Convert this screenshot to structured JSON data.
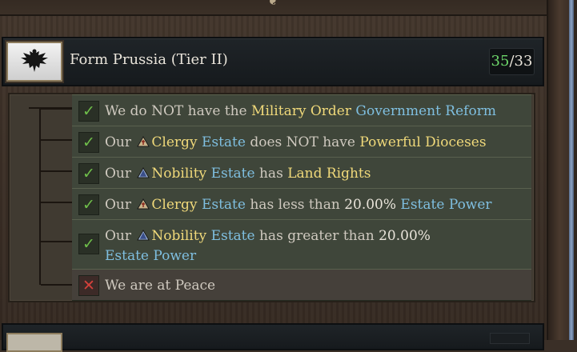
{
  "decision": {
    "title": "Form Prussia (Tier II)",
    "counter_current": "35",
    "counter_sep": "/",
    "counter_total": "33",
    "flag_icon": "black-eagle-flag-icon"
  },
  "conditions": [
    {
      "status": "met",
      "parts": [
        {
          "t": "We do NOT have the ",
          "c": "n"
        },
        {
          "t": "Military Order",
          "c": "y"
        },
        {
          "t": " ",
          "c": "n"
        },
        {
          "t": "Government Reform",
          "c": "b"
        }
      ]
    },
    {
      "status": "met",
      "parts": [
        {
          "t": "Our ",
          "c": "n"
        },
        {
          "icon": "clergy-estate-icon"
        },
        {
          "t": "Clergy",
          "c": "y"
        },
        {
          "t": " ",
          "c": "n"
        },
        {
          "t": "Estate",
          "c": "b"
        },
        {
          "t": " does NOT have ",
          "c": "n"
        },
        {
          "t": "Powerful Dioceses",
          "c": "y"
        }
      ]
    },
    {
      "status": "met",
      "parts": [
        {
          "t": "Our ",
          "c": "n"
        },
        {
          "icon": "nobility-estate-icon"
        },
        {
          "t": "Nobility",
          "c": "y"
        },
        {
          "t": " ",
          "c": "n"
        },
        {
          "t": "Estate",
          "c": "b"
        },
        {
          "t": " has ",
          "c": "n"
        },
        {
          "t": "Land Rights",
          "c": "y"
        }
      ]
    },
    {
      "status": "met",
      "parts": [
        {
          "t": "Our ",
          "c": "n"
        },
        {
          "icon": "clergy-estate-icon"
        },
        {
          "t": "Clergy",
          "c": "y"
        },
        {
          "t": " ",
          "c": "n"
        },
        {
          "t": "Estate",
          "c": "b"
        },
        {
          "t": " has less than ",
          "c": "n"
        },
        {
          "t": "20.00%",
          "c": "w"
        },
        {
          "t": " ",
          "c": "n"
        },
        {
          "t": "Estate Power",
          "c": "b"
        }
      ]
    },
    {
      "status": "met",
      "parts": [
        {
          "t": "Our ",
          "c": "n"
        },
        {
          "icon": "nobility-estate-icon"
        },
        {
          "t": "Nobility",
          "c": "y"
        },
        {
          "t": " ",
          "c": "n"
        },
        {
          "t": "Estate",
          "c": "b"
        },
        {
          "t": " has greater than ",
          "c": "n"
        },
        {
          "t": "20.00%",
          "c": "w"
        },
        {
          "br": true
        },
        {
          "t": "Estate Power",
          "c": "b"
        }
      ]
    },
    {
      "status": "failed",
      "parts": [
        {
          "t": "We are at Peace",
          "c": "n"
        }
      ]
    }
  ],
  "colors": {
    "met": "#6fbf4a",
    "failed": "#d5413b",
    "highlight": "#f0d97a",
    "link": "#7fbfe0",
    "counter_current": "#6ed86b"
  }
}
